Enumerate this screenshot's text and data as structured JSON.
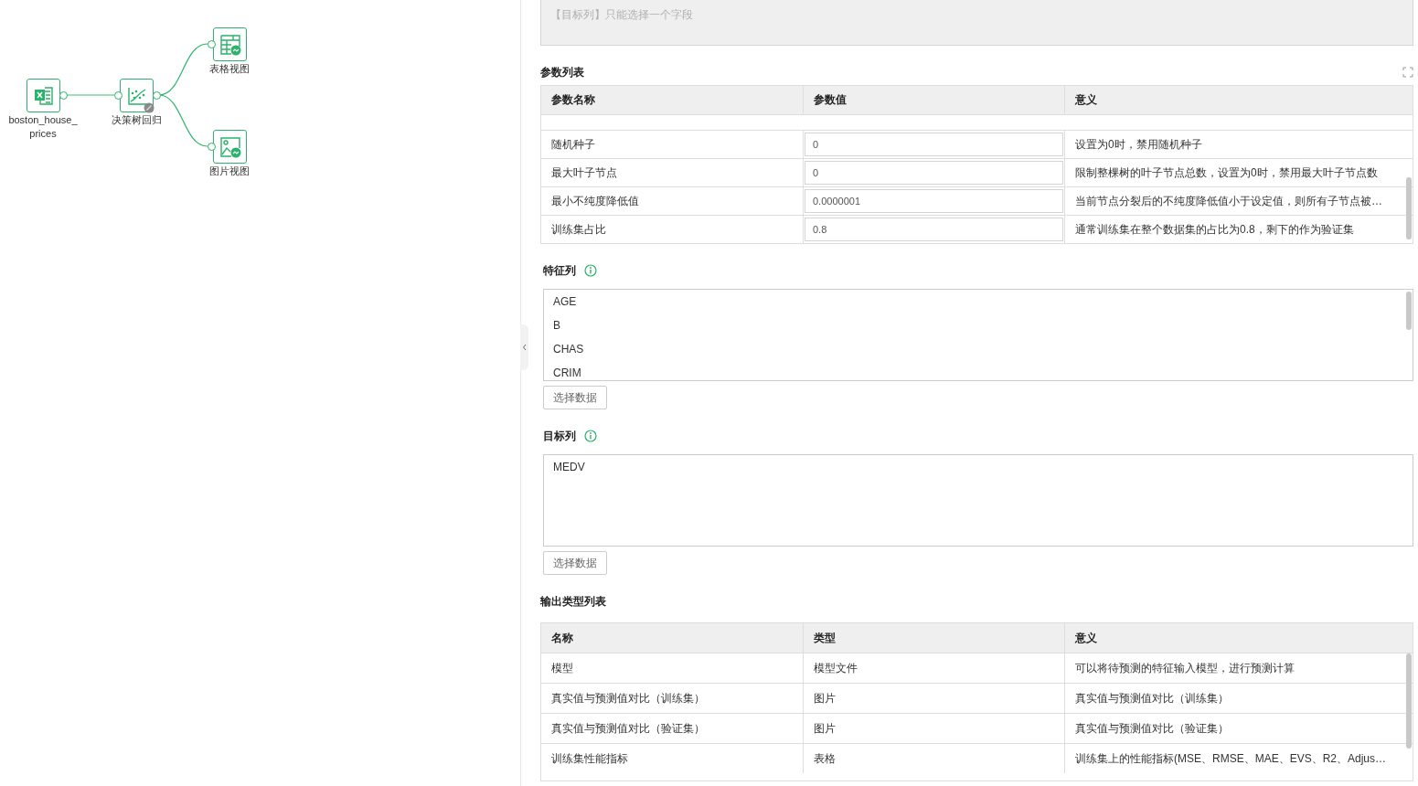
{
  "canvas": {
    "nodes": [
      {
        "kind": "excel",
        "label": "boston_house_ prices",
        "badge": false
      },
      {
        "kind": "model",
        "label": "决策树回归",
        "badge": true
      },
      {
        "kind": "table",
        "label": "表格视图",
        "badge": false
      },
      {
        "kind": "image",
        "label": "图片视图",
        "badge": false
      }
    ]
  },
  "panel": {
    "target_hint": {
      "placeholder": "【目标列】只能选择一个字段"
    },
    "params": {
      "title": "参数列表",
      "columns": [
        "参数名称",
        "参数值",
        "意义"
      ],
      "rows": [
        {
          "name": "随机种子",
          "value": "0",
          "meaning": "设置为0时，禁用随机种子"
        },
        {
          "name": "最大叶子节点",
          "value": "0",
          "meaning": "限制整棵树的叶子节点总数，设置为0时，禁用最大叶子节点数"
        },
        {
          "name": "最小不纯度降低值",
          "value": "0.0000001",
          "meaning": "当前节点分裂后的不纯度降低值小于设定值，则所有子节点被…"
        },
        {
          "name": "训练集占比",
          "value": "0.8",
          "meaning": "通常训练集在整个数据集的占比为0.8，剩下的作为验证集"
        }
      ]
    },
    "features": {
      "label": "特征列",
      "items": [
        "AGE",
        "B",
        "CHAS",
        "CRIM"
      ],
      "button": "选择数据"
    },
    "target": {
      "label": "目标列",
      "items": [
        "MEDV"
      ],
      "button": "选择数据"
    },
    "outputs": {
      "title": "输出类型列表",
      "columns": [
        "名称",
        "类型",
        "意义"
      ],
      "rows": [
        {
          "name": "模型",
          "type": "模型文件",
          "meaning": "可以将待预测的特征输入模型，进行预测计算"
        },
        {
          "name": "真实值与预测值对比（训练集）",
          "type": "图片",
          "meaning": "真实值与预测值对比（训练集）"
        },
        {
          "name": "真实值与预测值对比（验证集）",
          "type": "图片",
          "meaning": "真实值与预测值对比（验证集）"
        },
        {
          "name": "训练集性能指标",
          "type": "表格",
          "meaning": "训练集上的性能指标(MSE、RMSE、MAE、EVS、R2、Adjus…"
        }
      ]
    }
  }
}
